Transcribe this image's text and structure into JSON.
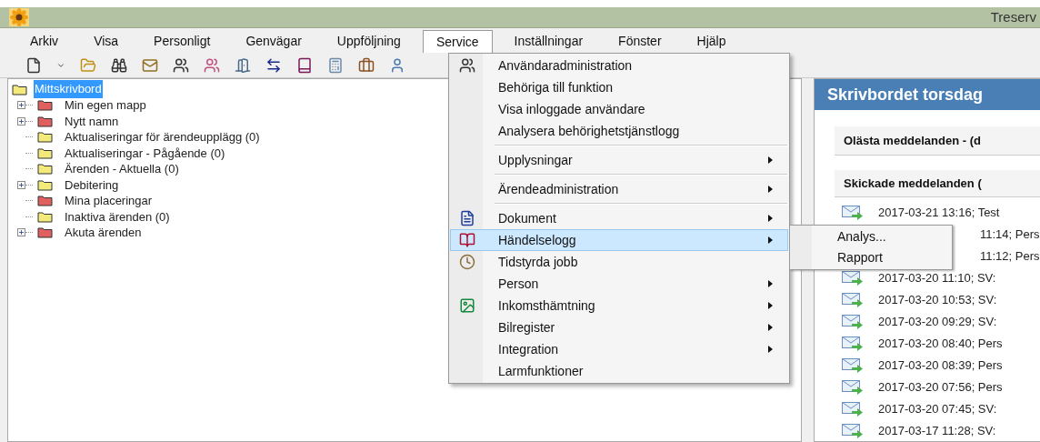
{
  "window": {
    "title": "Treserv"
  },
  "menubar": [
    {
      "label": "Arkiv",
      "selected": false
    },
    {
      "label": "Visa",
      "selected": false
    },
    {
      "label": "Personligt",
      "selected": false
    },
    {
      "label": "Genvägar",
      "selected": false
    },
    {
      "label": "Uppföljning",
      "selected": false
    },
    {
      "label": "Service",
      "selected": true
    },
    {
      "label": "Inställningar",
      "selected": false
    },
    {
      "label": "Fönster",
      "selected": false
    },
    {
      "label": "Hjälp",
      "selected": false
    }
  ],
  "tree": {
    "label": "Mittskrivbord",
    "selected": true,
    "children": [
      {
        "label": "Min egen mapp",
        "collapsible": true,
        "color": "#e06060"
      },
      {
        "label": "Nytt namn",
        "collapsible": true,
        "color": "#e06060"
      },
      {
        "label": "Aktualiseringar för ärendeupplägg (0)",
        "collapsible": false,
        "color": "#f2ea7a"
      },
      {
        "label": "Aktualiseringar - Pågående (0)",
        "collapsible": false,
        "color": "#f2ea7a"
      },
      {
        "label": "Ärenden - Aktuella (0)",
        "collapsible": false,
        "color": "#f2ea7a"
      },
      {
        "label": "Debitering",
        "collapsible": true,
        "color": "#f2ea7a"
      },
      {
        "label": "Mina placeringar",
        "collapsible": false,
        "color": "#e06060"
      },
      {
        "label": "Inaktiva ärenden (0)",
        "collapsible": false,
        "color": "#f2ea7a"
      },
      {
        "label": "Akuta ärenden",
        "collapsible": true,
        "color": "#e06060"
      }
    ]
  },
  "service_menu": [
    {
      "kind": "item",
      "label": "Användaradministration",
      "submenu": false,
      "selected": false
    },
    {
      "kind": "item",
      "label": "Behöriga till funktion",
      "submenu": false,
      "selected": false
    },
    {
      "kind": "item",
      "label": "Visa inloggade användare",
      "submenu": false,
      "selected": false
    },
    {
      "kind": "item",
      "label": "Analysera behörighetstjänstlogg",
      "submenu": false,
      "selected": false
    },
    {
      "kind": "separator"
    },
    {
      "kind": "item",
      "label": "Upplysningar",
      "submenu": true,
      "selected": false
    },
    {
      "kind": "separator"
    },
    {
      "kind": "item",
      "label": "Ärendeadministration",
      "submenu": true,
      "selected": false
    },
    {
      "kind": "separator"
    },
    {
      "kind": "item",
      "label": "Dokument",
      "submenu": true,
      "selected": false
    },
    {
      "kind": "item",
      "label": "Händelselogg",
      "submenu": true,
      "selected": true
    },
    {
      "kind": "item",
      "label": "Tidstyrda jobb",
      "submenu": false,
      "selected": false
    },
    {
      "kind": "item",
      "label": "Person",
      "submenu": true,
      "selected": false
    },
    {
      "kind": "item",
      "label": "Inkomsthämtning",
      "submenu": true,
      "selected": false
    },
    {
      "kind": "item",
      "label": "Bilregister",
      "submenu": true,
      "selected": false
    },
    {
      "kind": "item",
      "label": "Integration",
      "submenu": true,
      "selected": false
    },
    {
      "kind": "item",
      "label": "Larmfunktioner",
      "submenu": false,
      "selected": false
    }
  ],
  "submenu": [
    "Analys...",
    "Rapport"
  ],
  "desk": {
    "title": "Skrivbordet torsdag",
    "unread_heading": "Olästa meddelanden - (d",
    "sent_heading": "Skickade meddelanden (",
    "messages": [
      {
        "text": "2017-03-21 13:16; Test",
        "covered": false
      },
      {
        "text": "11:14; Pers",
        "covered": true
      },
      {
        "text": "11:12; Pers",
        "covered": true
      },
      {
        "text": "2017-03-20 11:10; SV:",
        "covered": false
      },
      {
        "text": "2017-03-20 10:53; SV:",
        "covered": false
      },
      {
        "text": "2017-03-20 09:29; SV:",
        "covered": false
      },
      {
        "text": "2017-03-20 08:40; Pers",
        "covered": false
      },
      {
        "text": "2017-03-20 08:39; Pers",
        "covered": false
      },
      {
        "text": "2017-03-20 07:56; Pers",
        "covered": false
      },
      {
        "text": "2017-03-20 07:45; SV:",
        "covered": false
      },
      {
        "text": "2017-03-17 11:28; SV:",
        "covered": false
      }
    ]
  }
}
